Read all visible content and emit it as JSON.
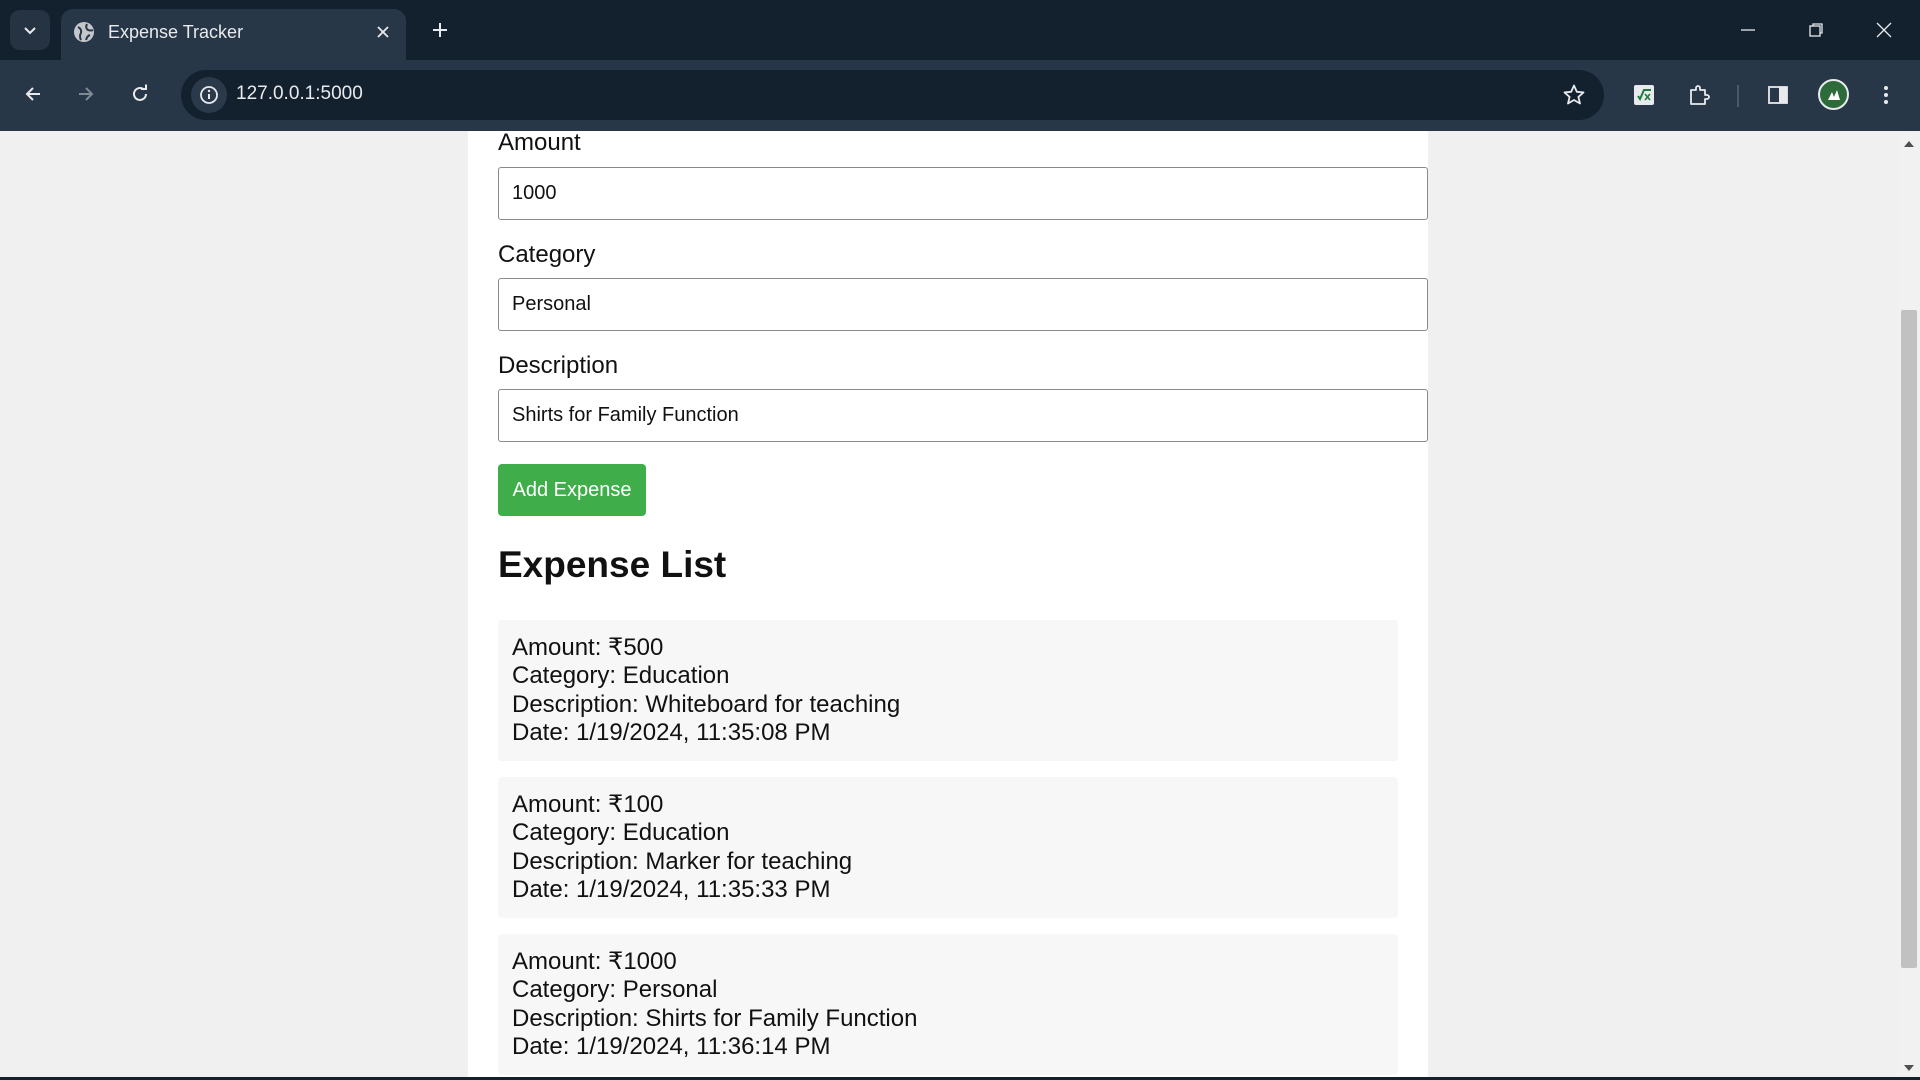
{
  "browser": {
    "tab_title": "Expense Tracker",
    "url": "127.0.0.1:5000",
    "icons": {
      "tab_search": "chevron-down-icon",
      "favicon": "globe-icon",
      "tab_close": "close-icon",
      "new_tab": "plus-icon",
      "minimize": "minimize-icon",
      "restore": "restore-icon",
      "close_window": "close-icon",
      "back": "arrow-left-icon",
      "forward": "arrow-right-icon",
      "reload": "reload-icon",
      "site_info": "info-icon",
      "bookmark": "star-icon",
      "extension_1": "spreadsheet-extension-icon",
      "extensions": "puzzle-icon",
      "side_panel": "side-panel-icon",
      "profile": "avatar",
      "menu": "more-vertical-icon"
    }
  },
  "form": {
    "amount": {
      "label": "Amount",
      "value": "1000"
    },
    "category": {
      "label": "Category",
      "value": "Personal"
    },
    "description": {
      "label": "Description",
      "value": "Shirts for Family Function"
    },
    "submit_label": "Add Expense"
  },
  "expense_list": {
    "heading": "Expense List",
    "items": [
      {
        "amount": "Amount: ₹500",
        "category": "Category: Education",
        "description": "Description: Whiteboard for teaching",
        "date": "Date: 1/19/2024, 11:35:08 PM"
      },
      {
        "amount": "Amount: ₹100",
        "category": "Category: Education",
        "description": "Description: Marker for teaching",
        "date": "Date: 1/19/2024, 11:35:33 PM"
      },
      {
        "amount": "Amount: ₹1000",
        "category": "Category: Personal",
        "description": "Description: Shirts for Family Function",
        "date": "Date: 1/19/2024, 11:36:14 PM"
      }
    ]
  },
  "colors": {
    "chrome_dark": "#13202e",
    "chrome_toolbar": "#283747",
    "button_green": "#3fad4a",
    "item_background": "#f7f7f7"
  }
}
